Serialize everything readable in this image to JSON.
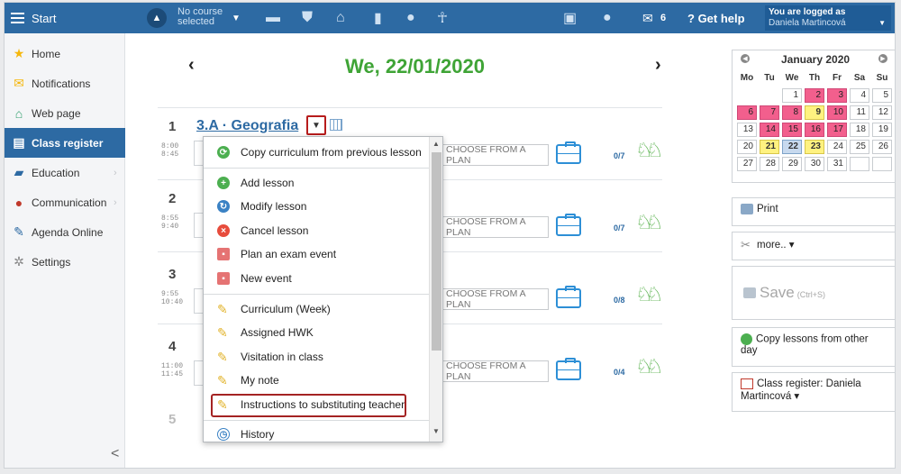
{
  "topbar": {
    "start": "Start",
    "course": "No course selected",
    "course_line1": "No course",
    "course_line2": "selected",
    "message_count": "6",
    "help": "Get help",
    "logged_label": "You are logged as",
    "user": "Daniela Martincová"
  },
  "sidebar": {
    "items": [
      {
        "label": "Home"
      },
      {
        "label": "Notifications"
      },
      {
        "label": "Web page"
      },
      {
        "label": "Class register"
      },
      {
        "label": "Education"
      },
      {
        "label": "Communication"
      },
      {
        "label": "Agenda Online"
      },
      {
        "label": "Settings"
      }
    ],
    "collapse": "<"
  },
  "main": {
    "date": "We, 22/01/2020",
    "prev": "‹",
    "next": "›",
    "subject": "3.A · Geografia",
    "lessons": [
      {
        "num": "1",
        "start": "8:00",
        "end": "8:45",
        "plan": "CHOOSE FROM A PLAN",
        "attendance": "0/7"
      },
      {
        "num": "2",
        "start": "8:55",
        "end": "9:40",
        "plan": "CHOOSE FROM A PLAN",
        "attendance": "0/7"
      },
      {
        "num": "3",
        "start": "9:55",
        "end": "10:40",
        "plan": "CHOOSE FROM A PLAN",
        "attendance": "0/8"
      },
      {
        "num": "4",
        "start": "11:00",
        "end": "11:45",
        "plan": "CHOOSE FROM A PLAN",
        "attendance": "0/4"
      },
      {
        "num": "5"
      }
    ]
  },
  "menu": {
    "items": [
      {
        "label": "Copy curriculum from previous lesson"
      },
      {
        "label": "Add lesson"
      },
      {
        "label": "Modify lesson"
      },
      {
        "label": "Cancel lesson"
      },
      {
        "label": "Plan an exam event"
      },
      {
        "label": "New event"
      },
      {
        "label": "Curriculum (Week)"
      },
      {
        "label": "Assigned HWK"
      },
      {
        "label": "Visitation in class"
      },
      {
        "label": "My note"
      },
      {
        "label": "Instructions to substituting teacher"
      },
      {
        "label": "History"
      }
    ]
  },
  "calendar": {
    "title": "January 2020",
    "dow": [
      "Mo",
      "Tu",
      "We",
      "Th",
      "Fr",
      "Sa",
      "Su"
    ],
    "weeks": [
      [
        "",
        "",
        "1",
        "2",
        "3",
        "4",
        "5"
      ],
      [
        "6",
        "7",
        "8",
        "9",
        "10",
        "11",
        "12"
      ],
      [
        "13",
        "14",
        "15",
        "16",
        "17",
        "18",
        "19"
      ],
      [
        "20",
        "21",
        "22",
        "23",
        "24",
        "25",
        "26"
      ],
      [
        "27",
        "28",
        "29",
        "30",
        "31",
        "",
        ""
      ]
    ],
    "highlight_colors": {
      "pink": "#f25f8d",
      "yellow": "#fff280",
      "selected": "#c7d9ee"
    }
  },
  "right": {
    "print": "Print",
    "more": "more.. ▾",
    "save": "Save",
    "save_hint": "(Ctrl+S)",
    "copy_lessons": "Copy lessons from other day",
    "class_register": "Class register: Daniela Martincová ▾"
  },
  "colors": {
    "accent": "#2d6aa3",
    "date": "#3fa436",
    "highlight": "#a42323"
  }
}
